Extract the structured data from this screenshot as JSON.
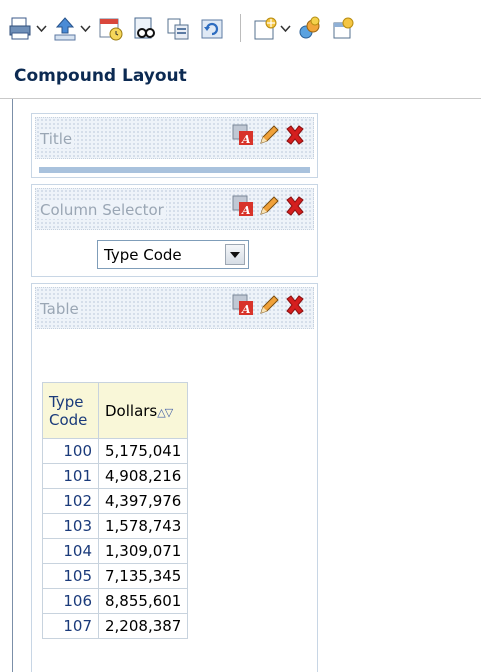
{
  "toolbar": {
    "icons": [
      "print-icon",
      "export-icon",
      "schedule-icon",
      "preview-icon",
      "copy-icon",
      "refresh-icon",
      "new-view-icon",
      "add-filter-icon",
      "add-prompt-icon"
    ]
  },
  "header": {
    "title": "Compound Layout"
  },
  "views": {
    "title_view": {
      "name": "Title"
    },
    "selector_view": {
      "name": "Column Selector",
      "selected": "Type Code"
    },
    "table_view": {
      "name": "Table"
    }
  },
  "table": {
    "col_code": "Type\nCode",
    "col_dollars": "Dollars",
    "rows": [
      {
        "code": "100",
        "dollars": "5,175,041"
      },
      {
        "code": "101",
        "dollars": "4,908,216"
      },
      {
        "code": "102",
        "dollars": "4,397,976"
      },
      {
        "code": "103",
        "dollars": "1,578,743"
      },
      {
        "code": "104",
        "dollars": "1,309,071"
      },
      {
        "code": "105",
        "dollars": "7,135,345"
      },
      {
        "code": "106",
        "dollars": "8,855,601"
      },
      {
        "code": "107",
        "dollars": "2,208,387"
      }
    ]
  },
  "colors": {
    "header_text": "#0c2a52",
    "delete_icon": "#d51e1e",
    "edit_icon": "#e08a1e",
    "table_header_bg": "#f9f7d8",
    "link_blue": "#1a3a7a"
  }
}
